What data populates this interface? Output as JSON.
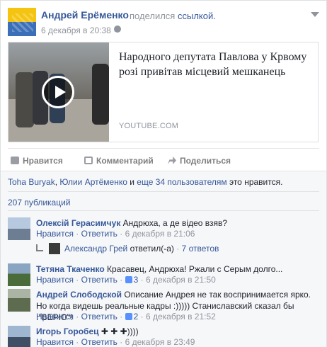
{
  "post": {
    "author": "Андрей Ерёменко",
    "shared_prefix": "поделился",
    "shared_link": "ссылкой.",
    "time": "6 декабря в 20:38 ·"
  },
  "link": {
    "title": "Народного депутата Павлова у Крвому розі привітав місцевий мешканець",
    "domain": "YOUTUBE.COM"
  },
  "actions": {
    "like": "Нравится",
    "comment": "Комментарий",
    "share": "Поделиться"
  },
  "likes": {
    "name1": "Toha Buryak",
    "name2": "Юлии Артёменко",
    "and": " и ",
    "others": "еще 34 пользователям",
    "suffix": " это нравится."
  },
  "shares": "207 публикаций",
  "comments": [
    {
      "author": "Олексій Герасимчук",
      "text": " Андрюха, а де відео взяв?",
      "like": "Нравится",
      "reply": "Ответить",
      "likes": "",
      "time": "6 декабря в 21:06"
    },
    {
      "author": "Тетяна Ткаченко",
      "text": " Красавец, Андрюха! Ржали с Серым долго...",
      "like": "Нравится",
      "reply": "Ответить",
      "likes": "3",
      "time": "6 декабря в 21:50"
    },
    {
      "author": "Андрей Слободской",
      "text": " Описание Андрея не так воспринимается ярко. Но когда видешь реальные кадры :))))) Станиславский сказал бы :\"ВЕРЮ\"!",
      "like": "Нравится",
      "reply": "Ответить",
      "likes": "2",
      "time": "6 декабря в 21:52"
    },
    {
      "author": "Игорь Горобец",
      "text": " ✚ ✚ ✚))))",
      "like": "Нравится",
      "reply": "Ответить",
      "likes": "",
      "time": "6 декабря в 23:49"
    }
  ],
  "reply_summary": {
    "name": "Александр Грей",
    "text": " ответил(-а)",
    "count": "7 ответов"
  },
  "colors": {
    "link": "#365899",
    "muted": "#90949c",
    "ufi_bg": "#f6f7f9"
  }
}
